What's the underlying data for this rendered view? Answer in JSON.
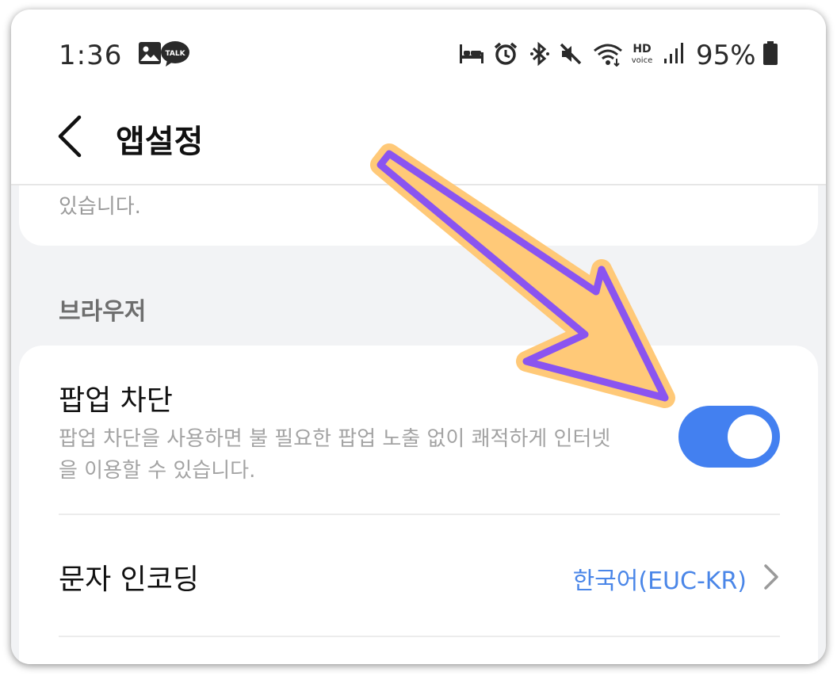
{
  "status_bar": {
    "time": "1:36",
    "talk_badge": "TALK",
    "hd_label": "HD",
    "voice_label": "voice",
    "battery": "95%"
  },
  "header": {
    "title": "앱설정",
    "back_icon": "chevron-left-icon"
  },
  "sections": {
    "previous_desc_tail": "있습니다.",
    "browser_header": "브라우저",
    "popup_block": {
      "title": "팝업 차단",
      "description": "팝업 차단을 사용하면 불 필요한 팝업 노출 없이 쾌적하게 인터넷을 이용할 수 있습니다.",
      "enabled": true
    },
    "encoding": {
      "title": "문자 인코딩",
      "value": "한국어(EUC-KR)"
    }
  },
  "colors": {
    "toggle_on": "#4380f0",
    "link_value": "#4a86e8",
    "arrow_fill": "#ffc978",
    "arrow_stroke": "#8a54f0"
  }
}
